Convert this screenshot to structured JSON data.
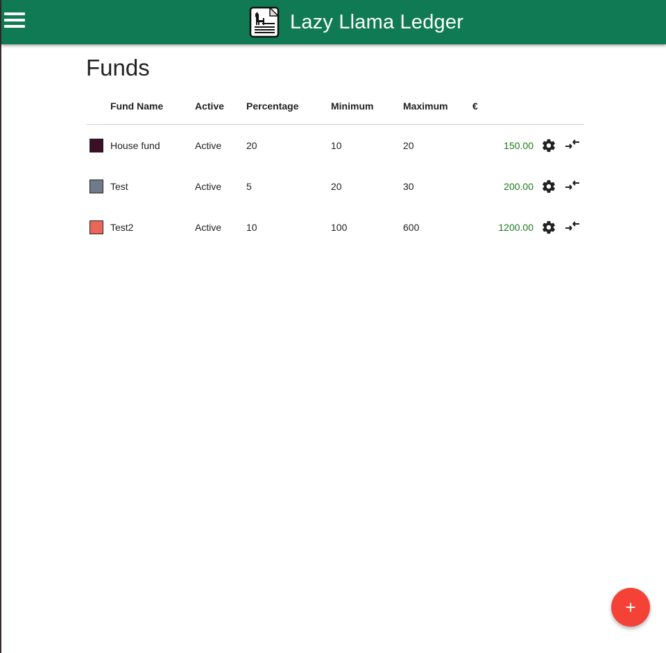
{
  "app": {
    "title": "Lazy Llama Ledger",
    "accent_color": "#107a55",
    "logo_icon": "ledger-llama-logo"
  },
  "header": {
    "menu_icon": "hamburger-menu-icon"
  },
  "page": {
    "title": "Funds"
  },
  "table": {
    "columns": {
      "name": "Fund Name",
      "active": "Active",
      "percentage": "Percentage",
      "minimum": "Minimum",
      "maximum": "Maximum",
      "amount": "€"
    },
    "rows": [
      {
        "color": "#3b0f24",
        "name": "House fund",
        "active": "Active",
        "percentage": "20",
        "minimum": "10",
        "maximum": "20",
        "amount": "150.00"
      },
      {
        "color": "#6f7b8b",
        "name": "Test",
        "active": "Active",
        "percentage": "5",
        "minimum": "20",
        "maximum": "30",
        "amount": "200.00"
      },
      {
        "color": "#e8675a",
        "name": "Test2",
        "active": "Active",
        "percentage": "10",
        "minimum": "100",
        "maximum": "600",
        "amount": "1200.00"
      }
    ],
    "row_icons": [
      "gear-icon",
      "transfer-arrows-icon"
    ],
    "amount_color": "#1b7a1b"
  },
  "fab": {
    "label": "+",
    "color": "#f44336",
    "icon": "add-icon"
  }
}
